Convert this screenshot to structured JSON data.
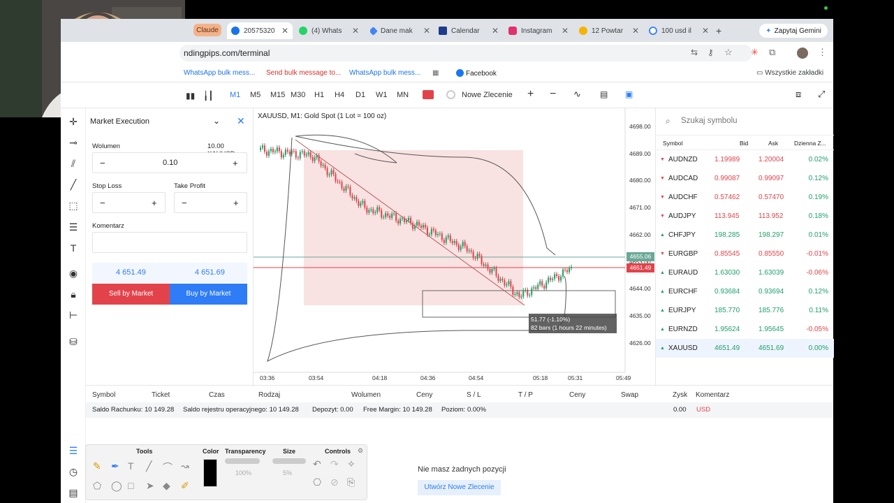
{
  "tabs": [
    {
      "label": "Claude",
      "color": "#d97757"
    },
    {
      "label": "20575320",
      "color": "#1a73e8"
    },
    {
      "label": "(4) Whats",
      "color": "#25d366"
    },
    {
      "label": "Dane mak",
      "color": "#4285f4"
    },
    {
      "label": "Calendar",
      "color": "#1f3a8a"
    },
    {
      "label": "Instagram",
      "color": "#e1306c"
    },
    {
      "label": "12 Powtar",
      "color": "#f4b400"
    },
    {
      "label": "100 usd il",
      "color": "#4285f4"
    }
  ],
  "gemini_label": "Zapytaj Gemini",
  "url": "ndingpips.com/terminal",
  "bookmarks": [
    {
      "label": "WhatsApp bulk mess...",
      "color": "#1a73e8"
    },
    {
      "label": "Send bulk message to...",
      "color": "#d93025"
    },
    {
      "label": "WhatsApp bulk mess...",
      "color": "#1a73e8"
    },
    {
      "label": "Facebook",
      "color": "#202124"
    }
  ],
  "bookmarks_all": "Wszystkie zakładki",
  "toolbar": {
    "timeframes": [
      "M1",
      "M5",
      "M15",
      "M30",
      "H1",
      "H4",
      "D1",
      "W1",
      "MN"
    ],
    "active_timeframe": "M1",
    "new_order": "Nowe Zlecenie"
  },
  "order": {
    "mode": "Market Execution",
    "volume_label": "Wolumen",
    "volume_info": "10.00 XAUUSD",
    "volume_value": "0.10",
    "stop_loss": "Stop Loss",
    "take_profit": "Take Profit",
    "comment_label": "Komentarz",
    "bid": "4 651.49",
    "ask": "4 651.69",
    "sell_label": "Sell by Market",
    "buy_label": "Buy by Market",
    "sell_color": "#e2434b",
    "buy_color": "#2e7cf6"
  },
  "chart": {
    "title": "XAUUSD, M1: Gold Spot (1 Lot = 100 oz)",
    "price_ticks": [
      "4698.00",
      "4689.00",
      "4680.00",
      "4671.00",
      "4662.00",
      "4653.00",
      "4644.00",
      "4635.00",
      "4626.00"
    ],
    "time_ticks": [
      "03:36",
      "03:54",
      "04:18",
      "04:36",
      "04:54",
      "05:18",
      "05:31",
      "05:49"
    ],
    "price_tag_green": "4655.06",
    "price_tag_red": "4651.49",
    "measure_line1": "51.77 (-1.10%)",
    "measure_line2": "82 bars (1 hours 22 minutes)"
  },
  "chart_data": {
    "type": "line",
    "title": "XAUUSD, M1: Gold Spot (1 Lot = 100 oz)",
    "x": [
      "03:36",
      "03:54",
      "04:18",
      "04:36",
      "04:54",
      "05:18",
      "05:31"
    ],
    "series": [
      {
        "values": [
          4694,
          4692,
          4673,
          4667,
          4658,
          4641,
          4651
        ]
      }
    ],
    "ylim": [
      4620,
      4702
    ],
    "grid": false
  },
  "watchlist": {
    "search_placeholder": "Szukaj symbolu",
    "headers": [
      "Symbol",
      "Bid",
      "Ask",
      "Dzienna Z..."
    ],
    "rows": [
      {
        "symbol": "AUDNZD",
        "bid": "1.19989",
        "ask": "1.20004",
        "change": "0.02%",
        "dir": "down"
      },
      {
        "symbol": "AUDCAD",
        "bid": "0.99087",
        "ask": "0.99097",
        "change": "0.12%",
        "dir": "down"
      },
      {
        "symbol": "AUDCHF",
        "bid": "0.57462",
        "ask": "0.57470",
        "change": "0.19%",
        "dir": "down"
      },
      {
        "symbol": "AUDJPY",
        "bid": "113.945",
        "ask": "113.952",
        "change": "0.18%",
        "dir": "down"
      },
      {
        "symbol": "CHFJPY",
        "bid": "198.285",
        "ask": "198.297",
        "change": "0.01%",
        "dir": "up"
      },
      {
        "symbol": "EURGBP",
        "bid": "0.85545",
        "ask": "0.85550",
        "change": "-0.01%",
        "dir": "down"
      },
      {
        "symbol": "EURAUD",
        "bid": "1.63030",
        "ask": "1.63039",
        "change": "-0.06%",
        "dir": "up"
      },
      {
        "symbol": "EURCHF",
        "bid": "0.93684",
        "ask": "0.93694",
        "change": "0.12%",
        "dir": "up"
      },
      {
        "symbol": "EURJPY",
        "bid": "185.770",
        "ask": "185.776",
        "change": "0.11%",
        "dir": "up"
      },
      {
        "symbol": "EURNZD",
        "bid": "1.95624",
        "ask": "1.95645",
        "change": "-0.05%",
        "dir": "up"
      },
      {
        "symbol": "XAUUSD",
        "bid": "4651.49",
        "ask": "4651.69",
        "change": "0.00%",
        "dir": "up"
      }
    ]
  },
  "positions": {
    "headers": [
      "Symbol",
      "Ticket",
      "Czas",
      "Rodzaj",
      "Wolumen",
      "Ceny",
      "S / L",
      "T / P",
      "Ceny",
      "Swap",
      "Zysk",
      "Komentarz"
    ],
    "saldo": "Saldo Rachunku: 10 149.28",
    "saldo_rej": "Saldo rejestru operacyjnego: 10 149.28",
    "depozyt": "Depozyt: 0.00",
    "free_margin": "Free Margin: 10 149.28",
    "poziom": "Poziom: 0.00%",
    "zysk": "0.00",
    "currency": "USD",
    "empty": "Nie masz żadnych pozycji",
    "create_btn": "Utwórz Nowe Zlecenie"
  },
  "drawtools": {
    "tools": "Tools",
    "color": "Color",
    "transparency": "Transparency",
    "size": "Size",
    "controls": "Controls",
    "transparency_value": "100%",
    "size_value": "5%"
  },
  "colors": {
    "up": "#1e9e6a",
    "down": "#e2434b",
    "accent": "#2e7cf6"
  }
}
